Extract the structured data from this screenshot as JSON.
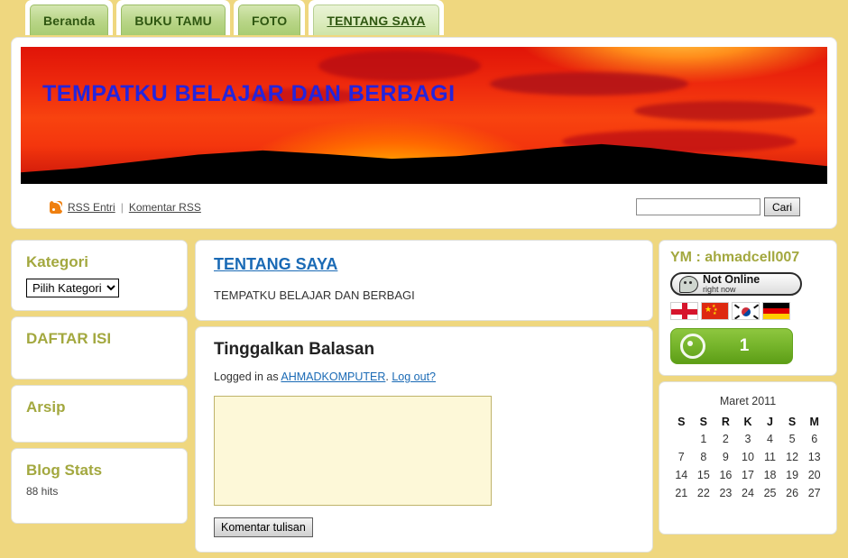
{
  "tabs": [
    {
      "label": "Beranda",
      "active": false
    },
    {
      "label": "BUKU TAMU",
      "active": false
    },
    {
      "label": "FOTO",
      "active": false
    },
    {
      "label": "TENTANG SAYA",
      "active": true
    }
  ],
  "banner": {
    "title": "TEMPATKU BELAJAR DAN BERBAGI"
  },
  "meta": {
    "rss_entries": "RSS Entri",
    "separator": "|",
    "rss_comments": "Komentar RSS"
  },
  "search": {
    "value": "",
    "placeholder": "",
    "button": "Cari"
  },
  "sidebar_left": {
    "categories": {
      "title": "Kategori",
      "selected": "Pilih Kategori",
      "options": [
        "Pilih Kategori"
      ]
    },
    "toc": {
      "title": "DAFTAR ISI"
    },
    "archive": {
      "title": "Arsip"
    },
    "stats": {
      "title": "Blog Stats",
      "hits": "88 hits"
    }
  },
  "main": {
    "post": {
      "title": "TENTANG SAYA",
      "body": "TEMPATKU BELAJAR DAN BERBAGI"
    },
    "reply": {
      "heading": "Tinggalkan Balasan",
      "logged_prefix": "Logged in as",
      "username": "AHMADKOMPUTER",
      "logged_suffix": ".",
      "logout": "Log out?",
      "comment_value": "",
      "submit": "Komentar tulisan"
    }
  },
  "sidebar_right": {
    "ym": {
      "title": "YM : ahmadcell007",
      "status_main": "Not Online",
      "status_sub": "right now"
    },
    "flags": [
      {
        "name": "flag-england"
      },
      {
        "name": "flag-china"
      },
      {
        "name": "flag-south-korea"
      },
      {
        "name": "flag-germany"
      }
    ],
    "counter": {
      "value": "1"
    },
    "calendar": {
      "title": "Maret 2011",
      "weekdays": [
        "S",
        "S",
        "R",
        "K",
        "J",
        "S",
        "M"
      ],
      "weeks": [
        [
          "",
          "1",
          "2",
          "3",
          "4",
          "5",
          "6"
        ],
        [
          "7",
          "8",
          "9",
          "10",
          "11",
          "12",
          "13"
        ],
        [
          "14",
          "15",
          "16",
          "17",
          "18",
          "19",
          "20"
        ],
        [
          "21",
          "22",
          "23",
          "24",
          "25",
          "26",
          "27"
        ]
      ]
    }
  },
  "colors": {
    "page_background": "#efd77f",
    "tab_green": "#b8d587",
    "widget_title": "#a3a83f",
    "link_blue": "#1a6ab5",
    "banner_text": "#2424dd",
    "counter_green": "#76b52b"
  }
}
